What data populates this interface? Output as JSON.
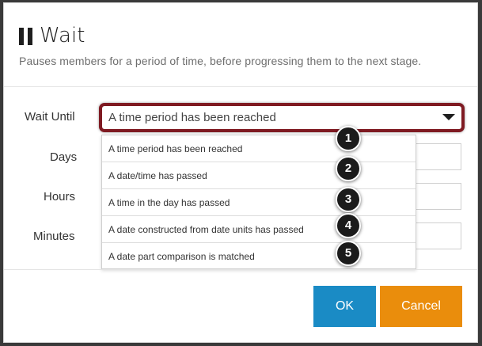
{
  "dialog": {
    "title": "Wait",
    "subtitle": "Pauses members for a period of time, before progressing them to the next stage."
  },
  "form": {
    "wait_until_label": "Wait Until",
    "days_label": "Days",
    "hours_label": "Hours",
    "minutes_label": "Minutes",
    "selected_value": "A time period has been reached"
  },
  "dropdown": {
    "options": [
      "A time period has been reached",
      "A date/time has passed",
      "A time in the day has passed",
      "A date constructed from date units has passed",
      "A date part comparison is matched"
    ]
  },
  "callouts": [
    "1",
    "2",
    "3",
    "4",
    "5"
  ],
  "buttons": {
    "ok_label": "OK",
    "cancel_label": "Cancel"
  },
  "colors": {
    "select_highlight": "#7f1a22",
    "ok_button": "#1a8bc5",
    "cancel_button": "#ea8d0c",
    "badge": "#1b1b1b"
  }
}
